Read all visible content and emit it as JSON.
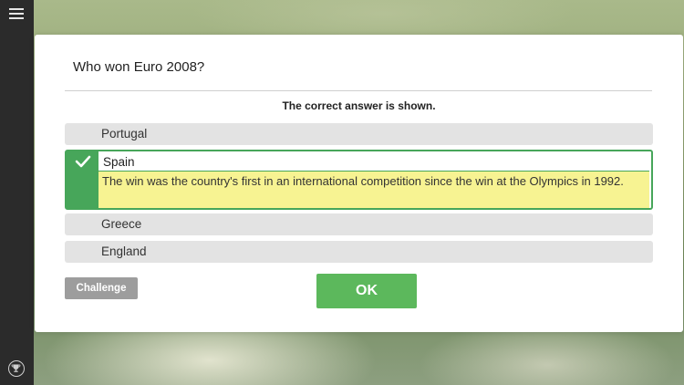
{
  "question": "Who won Euro 2008?",
  "status": "The correct answer is shown.",
  "answers": [
    {
      "label": "Portugal",
      "correct": false
    },
    {
      "label": "Spain",
      "correct": true,
      "explanation": "The win was the country's first in an international competition since the win at the Olympics in 1992."
    },
    {
      "label": "Greece",
      "correct": false
    },
    {
      "label": "England",
      "correct": false
    }
  ],
  "buttons": {
    "challenge": "Challenge",
    "ok": "OK"
  },
  "icons": {
    "menu": "hamburger-menu-icon",
    "trophy": "trophy-icon",
    "check": "checkmark-icon"
  },
  "colors": {
    "correct": "#47a65a",
    "ok_button": "#5cb85c",
    "highlight": "#f7f392",
    "sidebar": "#2b2b2b"
  }
}
